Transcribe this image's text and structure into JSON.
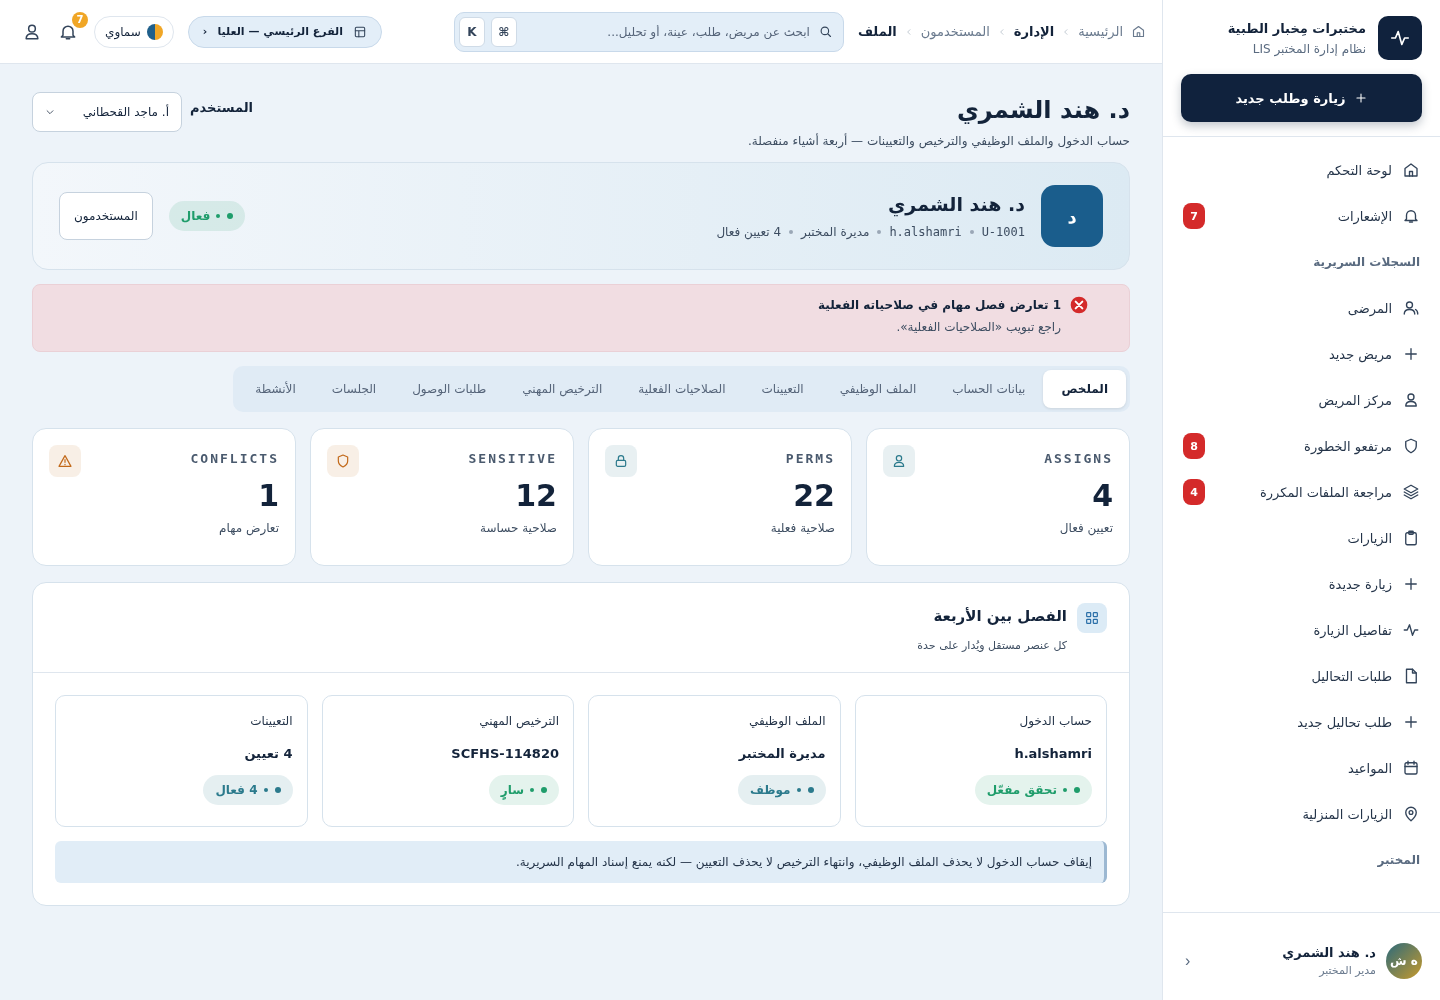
{
  "sidebar": {
    "brand_title": "مختبرات مِخبار الطبية",
    "brand_subtitle": "نظام إدارة المختبر LIS",
    "new_button": "زيارة وطلب جديد",
    "items": [
      {
        "kind": "item",
        "label": "لوحة التحكم"
      },
      {
        "kind": "item",
        "label": "الإشعارات",
        "badge": "7"
      },
      {
        "kind": "section",
        "label": "السجلات السريرية"
      },
      {
        "kind": "item",
        "label": "المرضى"
      },
      {
        "kind": "item",
        "label": "مريض جديد"
      },
      {
        "kind": "item",
        "label": "مركز المريض"
      },
      {
        "kind": "item",
        "label": "مرتفعو الخطورة",
        "badge": "8"
      },
      {
        "kind": "item",
        "label": "مراجعة الملفات المكررة",
        "badge": "4"
      },
      {
        "kind": "item",
        "label": "الزيارات"
      },
      {
        "kind": "item",
        "label": "زيارة جديدة"
      },
      {
        "kind": "item",
        "label": "تفاصيل الزيارة"
      },
      {
        "kind": "item",
        "label": "طلبات التحاليل"
      },
      {
        "kind": "item",
        "label": "طلب تحاليل جديد"
      },
      {
        "kind": "item",
        "label": "المواعيد"
      },
      {
        "kind": "item",
        "label": "الزيارات المنزلية"
      },
      {
        "kind": "section",
        "label": "المختبر"
      }
    ],
    "user": {
      "initials": "ه ش",
      "name": "د. هند الشمري",
      "role": "مدير المختبر",
      "chevron": "‹"
    }
  },
  "header": {
    "breadcrumbs": [
      {
        "label": "الرئيسية",
        "bold": false
      },
      {
        "label": "الإدارة",
        "bold": true
      },
      {
        "label": "المستخدمون",
        "bold": false
      },
      {
        "label": "الملف",
        "bold": true
      }
    ],
    "search": {
      "placeholder": "ابحث عن مريض، طلب، عينة، أو تحليل..."
    },
    "keys": [
      "⌘",
      "K"
    ],
    "branch": {
      "label": "الفرع الرئيسي — العليا",
      "chevron": "‹"
    },
    "theme": "سماوي",
    "notifications_badge": "7"
  },
  "page": {
    "title": "د. هند الشمري",
    "subtitle": "حساب الدخول والملف الوظيفي والترخيص والتعيينات — أربعة أشياء منفصلة.",
    "user_select": {
      "label": "المستخدم",
      "value": "أ. ماجد القحطاني"
    }
  },
  "profile": {
    "avatar": "د",
    "name": "د. هند الشمري",
    "meta": [
      "U-1001",
      "h.alshamri",
      "مديرة المختبر",
      "4 تعيين فعال"
    ],
    "status": {
      "label": "فعال",
      "color": "#1f9d6b"
    },
    "button": "المستخدمون"
  },
  "alert": {
    "title": "1 تعارض فصل مهام في صلاحياته الفعلية",
    "text": "راجع تبويب «الصلاحيات الفعلية»."
  },
  "tabs": [
    {
      "label": "الملخص",
      "selected": true
    },
    {
      "label": "بيانات الحساب",
      "selected": false
    },
    {
      "label": "الملف الوظيفي",
      "selected": false
    },
    {
      "label": "التعيينات",
      "selected": false
    },
    {
      "label": "الصلاحيات الفعلية",
      "selected": false
    },
    {
      "label": "الترخيص المهني",
      "selected": false
    },
    {
      "label": "طلبات الوصول",
      "selected": false
    },
    {
      "label": "الجلسات",
      "selected": false
    },
    {
      "label": "الأنشطة",
      "selected": false
    }
  ],
  "stats": [
    {
      "label": "ASSIGNS",
      "value": "4",
      "caption": "تعيين فعال",
      "color": "#2b7a8c"
    },
    {
      "label": "PERMS",
      "value": "22",
      "caption": "صلاحية فعلية",
      "color": "#2b7a8c"
    },
    {
      "label": "SENSITIVE",
      "value": "12",
      "caption": "صلاحية حساسة",
      "color": "#c2691a"
    },
    {
      "label": "CONFLICTS",
      "value": "1",
      "caption": "تعارض مهام",
      "color": "#c2691a"
    }
  ],
  "separation": {
    "title": "الفصل بين الأربعة",
    "subtitle": "كل عنصر مستقل ويُدار على حدة",
    "items": [
      {
        "label": "حساب الدخول",
        "value": "h.alshamri",
        "chip": {
          "label": "تحقق مفعّل",
          "color": "#1f9d6b"
        }
      },
      {
        "label": "الملف الوظيفي",
        "value": "مديرة المختبر",
        "chip": {
          "label": "موظف",
          "color": "#2b7a8c"
        }
      },
      {
        "label": "الترخيص المهني",
        "value": "SCFHS-114820",
        "chip": {
          "label": "سارٍ",
          "color": "#1f9d6b"
        }
      },
      {
        "label": "التعيينات",
        "value": "4 تعيين",
        "chip": {
          "label": "4 فعال",
          "color": "#2b7a8c"
        }
      }
    ],
    "note": "إيقاف حساب الدخول لا يحذف الملف الوظيفي، وانتهاء الترخيص لا يحذف التعيين — لكنه يمنع إسناد المهام السريرية."
  }
}
